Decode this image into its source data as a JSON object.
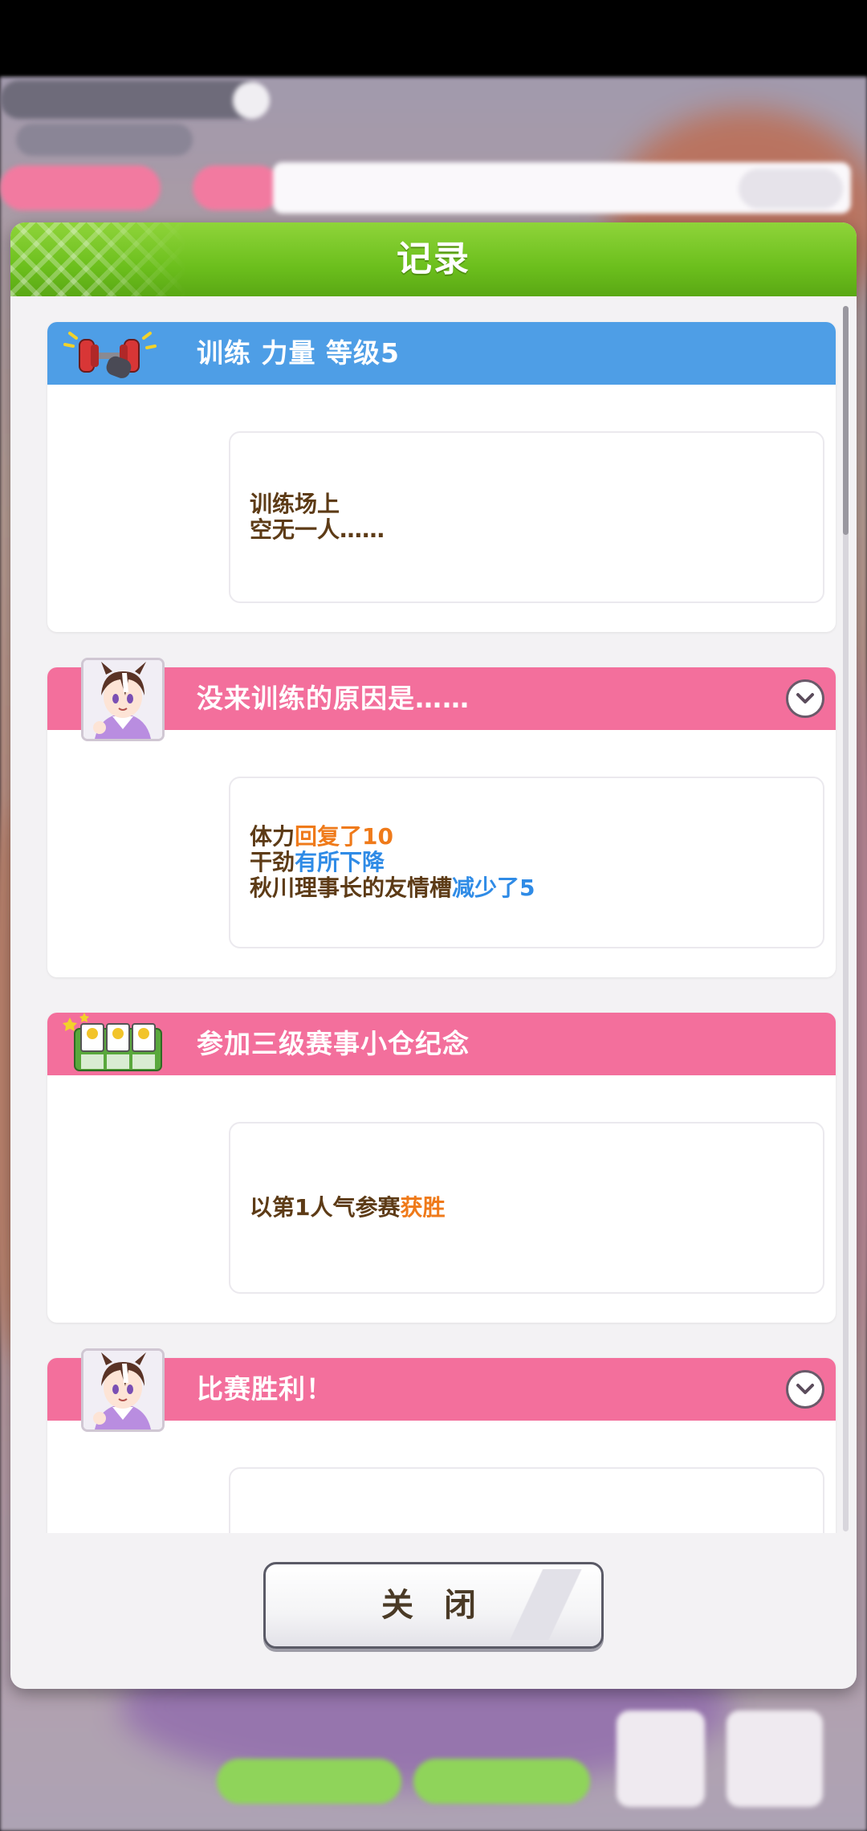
{
  "colors": {
    "header_green": "#6cbf1d",
    "section_blue": "#4e9ee6",
    "section_pink": "#f36f9c",
    "text_brown": "#5d3b16",
    "highlight_orange": "#ef7a1a",
    "highlight_blue": "#2f8be6"
  },
  "modal": {
    "title": "记录",
    "close_label": "关 闭"
  },
  "entries": [
    {
      "icon": "dumbbell-icon",
      "title": "训练  力量  等级5",
      "lines": [
        [
          {
            "t": "训练场上"
          }
        ],
        [
          {
            "t": "空无一人……"
          }
        ]
      ]
    },
    {
      "icon": "character-portrait",
      "title": "没来训练的原因是……",
      "expandable": true,
      "lines": [
        [
          {
            "t": "体力"
          },
          {
            "t": "回复了10",
            "c": "o"
          }
        ],
        [
          {
            "t": "干劲"
          },
          {
            "t": "有所下降",
            "c": "b"
          }
        ],
        [
          {
            "t": "秋川理事长的友情槽"
          },
          {
            "t": "减少了5",
            "c": "b"
          }
        ]
      ]
    },
    {
      "icon": "race-cards-icon",
      "title": "参加三级赛事小仓纪念",
      "lines": [
        [
          {
            "t": "以第1人气参赛"
          },
          {
            "t": "获胜",
            "c": "o"
          }
        ]
      ]
    },
    {
      "icon": "character-portrait",
      "title": "比赛胜利！",
      "expandable": true,
      "lines": []
    }
  ]
}
